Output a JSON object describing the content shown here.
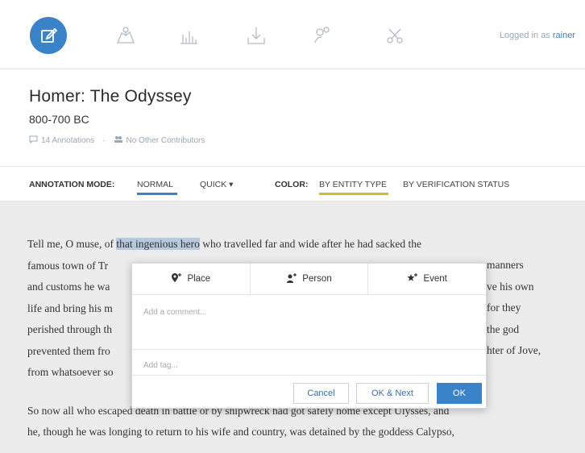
{
  "nav": {
    "icons": [
      "edit-icon",
      "map-icon",
      "chart-icon",
      "download-icon",
      "people-icon",
      "tools-icon"
    ],
    "login_prefix": "Logged in as",
    "login_user": "rainer"
  },
  "header": {
    "title": "Homer: The Odyssey",
    "date": "800-700 BC",
    "annotations": "14 Annotations",
    "contributors": "No Other Contributors"
  },
  "modebar": {
    "mode_label": "ANNOTATION MODE:",
    "mode_normal": "NORMAL",
    "mode_quick": "QUICK ▾",
    "color_label": "COLOR:",
    "color_entity": "BY ENTITY TYPE",
    "color_verification": "BY VERIFICATION STATUS"
  },
  "text": {
    "p1_before": "Tell me, O muse, of ",
    "p1_highlight": "that ingenious hero",
    "p1_after": " who travelled far and wide after he had sacked the",
    "lines": [
      "famous town of Tr",
      "and customs he wa",
      "life and bring his m",
      "perished through th",
      "prevented them fro",
      "from whatsoever so"
    ],
    "right_fragments": [
      " manners",
      "ve his own",
      "for they",
      " the god",
      "hter of Jove,",
      ""
    ],
    "p2_line1": "So now all who escaped death in battle or by shipwreck had got safely home except Ulysses, and",
    "p2_line2": "he, though he was longing to return to his wife and country, was detained by the goddess Calypso,"
  },
  "popup": {
    "tab_place": "Place",
    "tab_person": "Person",
    "tab_event": "Event",
    "comment_placeholder": "Add a comment...",
    "tag_placeholder": "Add tag...",
    "cancel": "Cancel",
    "ok_next": "OK & Next",
    "ok": "OK"
  },
  "colors": {
    "accent": "#3a83c8",
    "highlight": "#b7c9dc",
    "entity_underline": "#c9c12c"
  }
}
